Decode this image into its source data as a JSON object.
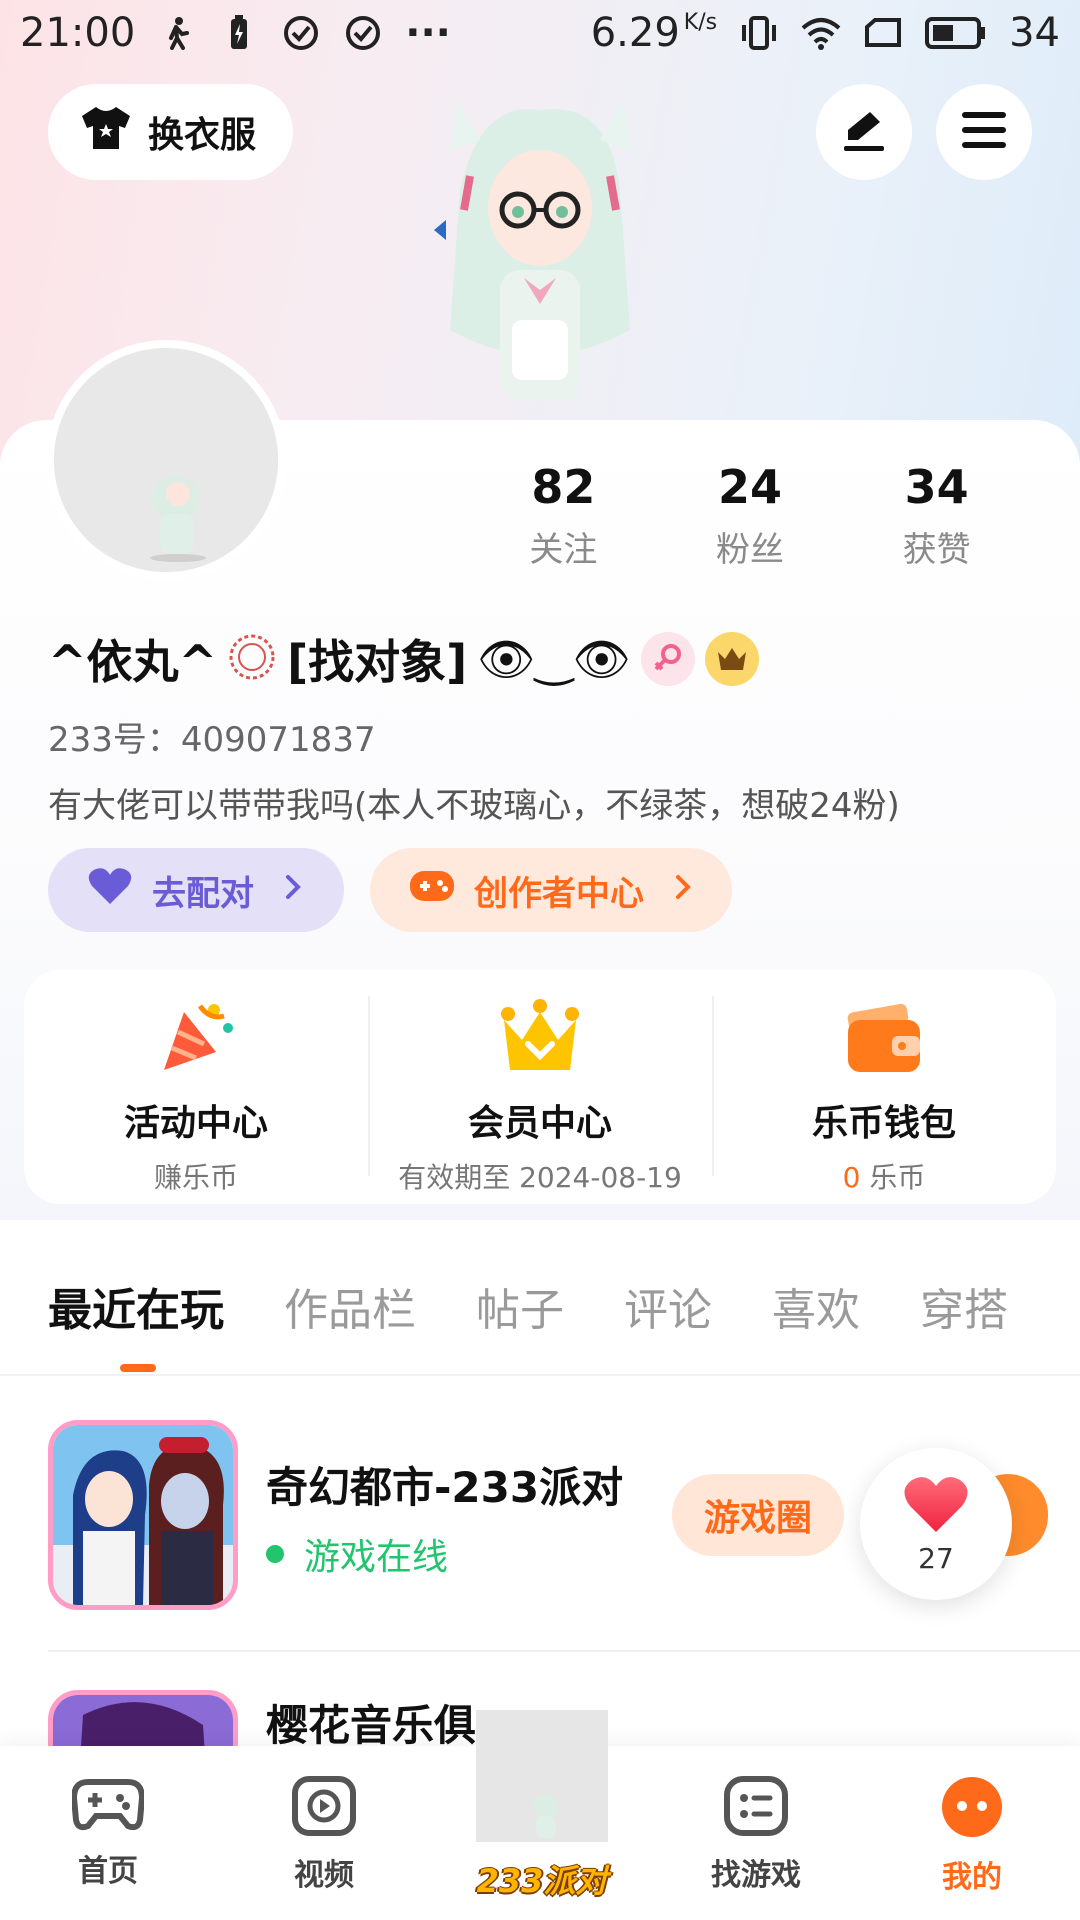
{
  "status_bar": {
    "time": "21:00",
    "speed": "6.29",
    "speed_unit": "K/s",
    "battery": "34",
    "more": "···"
  },
  "header": {
    "outfit_label": "换衣服"
  },
  "profile": {
    "stats": [
      {
        "value": "82",
        "label": "关注"
      },
      {
        "value": "24",
        "label": "粉丝"
      },
      {
        "value": "34",
        "label": "获赞"
      }
    ],
    "username": "^依丸^",
    "username_tail": "[找对象]",
    "emoji_tail": "👁‿👁",
    "id_line": "233号：409071837",
    "bio": "有大佬可以带带我吗(本人不玻璃心，不绿茶，想破24粉)",
    "match_label": "去配对",
    "creator_label": "创作者中心"
  },
  "centers": [
    {
      "title": "活动中心",
      "sub": "赚乐币"
    },
    {
      "title": "会员中心",
      "sub": "有效期至 2024-08-19"
    },
    {
      "title": "乐币钱包",
      "sub_value": "0",
      "sub_unit": " 乐币"
    }
  ],
  "tabs": [
    "最近在玩",
    "作品栏",
    "帖子",
    "评论",
    "喜欢",
    "穿搭"
  ],
  "games": [
    {
      "name": "奇幻都市-233派对",
      "status": "游戏在线",
      "button": "游戏圈"
    },
    {
      "name": "樱花音乐俱"
    }
  ],
  "like_count": "27",
  "bottom_nav": [
    {
      "label": "首页"
    },
    {
      "label": "视频"
    },
    {
      "label": "233派对"
    },
    {
      "label": "找游戏"
    },
    {
      "label": "我的"
    }
  ],
  "colors": {
    "accent": "#ff6a1a",
    "match_purple": "#6a5cd6",
    "online_green": "#22c46e"
  }
}
